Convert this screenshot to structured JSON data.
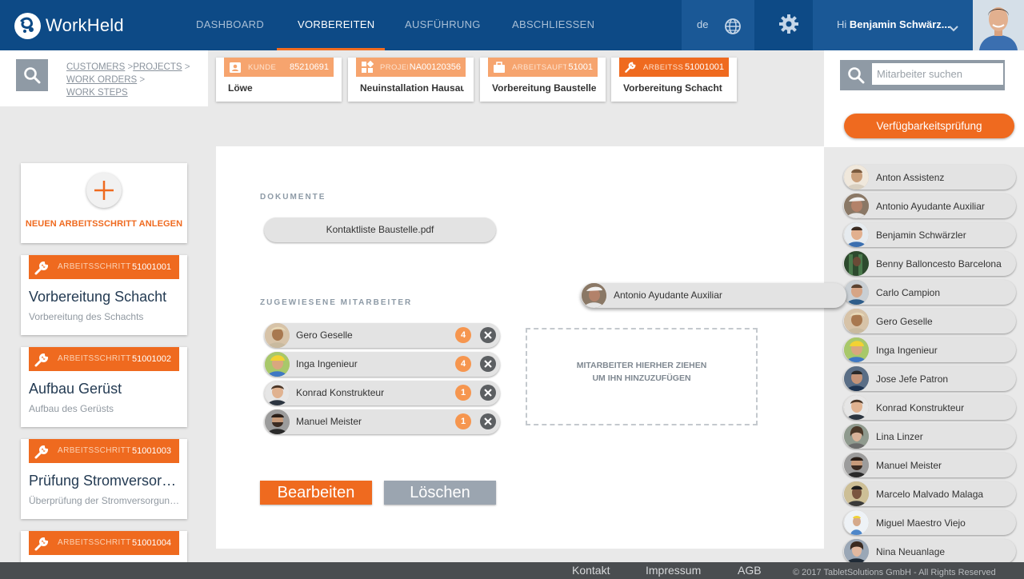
{
  "header": {
    "logo_text": "WorkHeld",
    "nav": [
      {
        "label": "DASHBOARD",
        "active": false
      },
      {
        "label": "VORBEREITEN",
        "active": true
      },
      {
        "label": "AUSFÜHRUNG",
        "active": false
      },
      {
        "label": "ABSCHLIESSEN",
        "active": false
      }
    ],
    "language": "de",
    "greeting": "Hi",
    "user_name": "Benjamin Schwärz...",
    "accent_color": "#f26d21",
    "nav_bg": "#0d4a86"
  },
  "breadcrumb": {
    "items": [
      "CUSTOMERS",
      "PROJECTS",
      "WORK ORDERS",
      "WORK STEPS"
    ],
    "separator": ">"
  },
  "context_cards": [
    {
      "icon": "person-badge-icon",
      "type": "KUNDE",
      "number": "85210691",
      "title": "Löwe"
    },
    {
      "icon": "project-grid-icon",
      "type": "PROJEKT",
      "number": "NA00120356",
      "title": "Neuinstallation Hausauf"
    },
    {
      "icon": "briefcase-icon",
      "type": "ARBEITSAUFTRAG",
      "number": "51001",
      "title": "Vorbereitung Baustelle I"
    },
    {
      "icon": "wrench-icon",
      "type": "ARBEITSSCHRITT",
      "number": "51001001",
      "title": "Vorbereitung Schacht"
    }
  ],
  "sidebar": {
    "new_step_label": "NEUEN ARBEITSSCHRITT ANLEGEN",
    "steps": [
      {
        "type": "ARBEITSSCHRITT",
        "number": "51001001",
        "title": "Vorbereitung Schacht",
        "subtitle": "Vorbereitung des Schachts"
      },
      {
        "type": "ARBEITSSCHRITT",
        "number": "51001002",
        "title": "Aufbau Gerüst",
        "subtitle": "Aufbau des Gerüsts"
      },
      {
        "type": "ARBEITSSCHRITT",
        "number": "51001003",
        "title": "Prüfung Stromversorg...",
        "subtitle": "Überprüfung der Stromversorgung..."
      },
      {
        "type": "ARBEITSSCHRITT",
        "number": "51001004",
        "title": "",
        "subtitle": ""
      }
    ]
  },
  "main": {
    "documents_label": "DOKUMENTE",
    "document": "Kontaktliste Baustelle.pdf",
    "assigned_label": "ZUGEWIESENE MITARBEITER",
    "assigned": [
      {
        "name": "Gero Geselle",
        "count": "4"
      },
      {
        "name": "Inga Ingenieur",
        "count": "4"
      },
      {
        "name": "Konrad Konstrukteur",
        "count": "1"
      },
      {
        "name": "Manuel Meister",
        "count": "1"
      }
    ],
    "drop_line1": "MITARBEITER HIERHER ZIEHEN",
    "drop_line2": "UM IHN HINZUZUFÜGEN",
    "edit_label": "Bearbeiten",
    "delete_label": "Löschen",
    "dragging_name": "Antonio Ayudante Auxiliar"
  },
  "right_panel": {
    "search_placeholder": "Mitarbeiter suchen",
    "availability_label": "Verfügbarkeitsprüfung",
    "employees": [
      "Anton Assistenz",
      "Antonio Ayudante Auxiliar",
      "Benjamin Schwärzler",
      "Benny Balloncesto Barcelona",
      "Carlo Campion",
      "Gero Geselle",
      "Inga Ingenieur",
      "Jose Jefe Patron",
      "Konrad Konstrukteur",
      "Lina Linzer",
      "Manuel Meister",
      "Marcelo Malvado Malaga",
      "Miguel Maestro Viejo",
      "Nina Neuanlage"
    ]
  },
  "footer": {
    "links": [
      "Kontakt",
      "Impressum",
      "AGB"
    ],
    "copyright": "© 2017 TabletSolutions GmbH - All Rights Reserved"
  }
}
